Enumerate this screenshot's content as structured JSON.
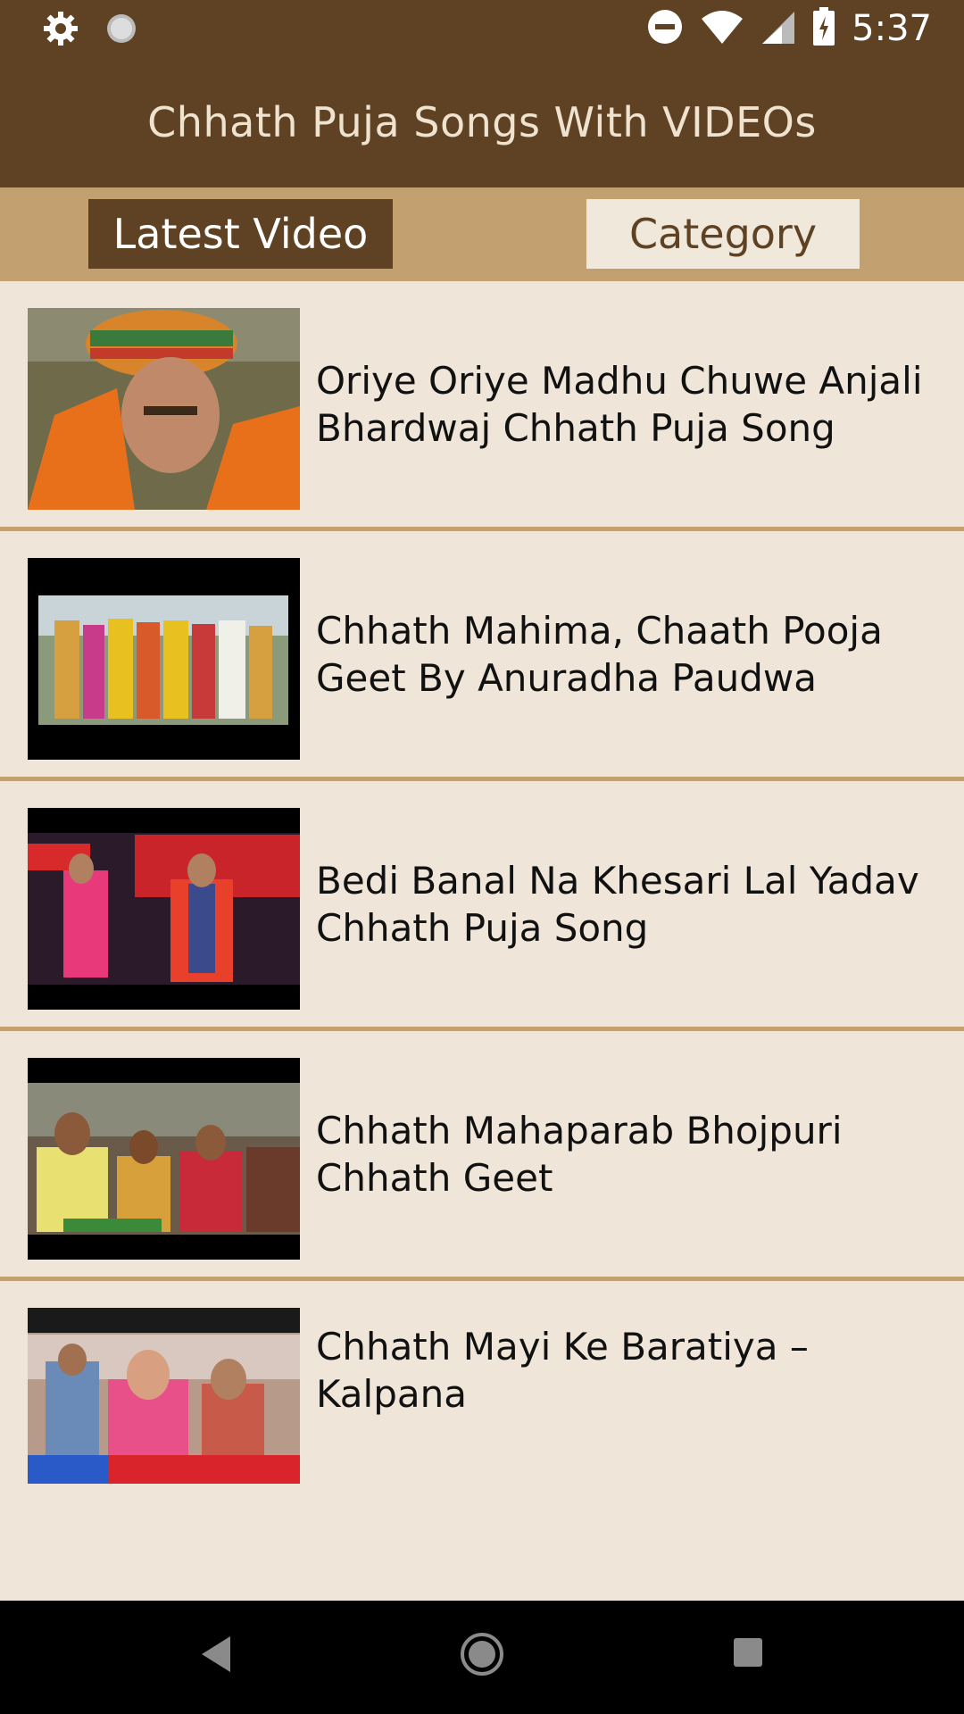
{
  "status_bar": {
    "time": "5:37",
    "icons": [
      "gear-icon",
      "sync-icon",
      "do-not-disturb-icon",
      "wifi-icon",
      "cell-signal-icon",
      "battery-icon"
    ]
  },
  "app_bar": {
    "title": "Chhath Puja Songs With VIDEOs"
  },
  "tabs": [
    {
      "label": "Latest Video",
      "selected": true
    },
    {
      "label": "Category",
      "selected": false
    }
  ],
  "videos": [
    {
      "title": "Oriye Oriye Madhu Chuwe Anjali Bhardwaj Chhath Puja Song"
    },
    {
      "title": "Chhath Mahima, Chaath Pooja Geet By Anuradha Paudwa"
    },
    {
      "title": "Bedi Banal Na Khesari Lal Yadav Chhath Puja Song"
    },
    {
      "title": "Chhath Mahaparab Bhojpuri Chhath Geet"
    },
    {
      "title": "Chhath Mayi Ke Baratiya – Kalpana"
    }
  ],
  "nav_bar": {
    "buttons": [
      "back-icon",
      "home-icon",
      "recents-icon"
    ]
  },
  "colors": {
    "primary": "#5e4223",
    "accent": "#c3a070",
    "background": "#efe6d9"
  }
}
